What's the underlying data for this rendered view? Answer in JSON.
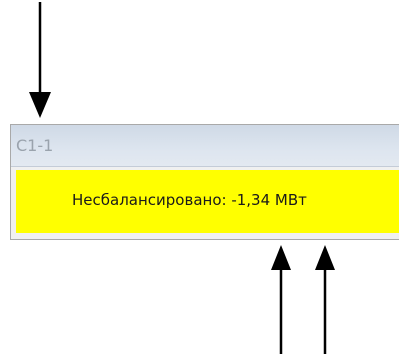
{
  "panel": {
    "title": "С1-1",
    "status_text": "Несбалансировано: -1,34 МВт"
  },
  "colors": {
    "body_background": "#ffff00",
    "header_text": "#9aa3ad",
    "arrow": "#000000"
  }
}
